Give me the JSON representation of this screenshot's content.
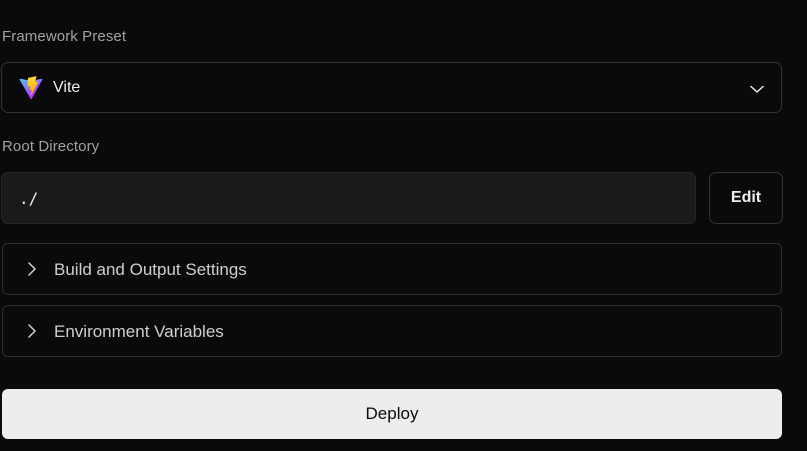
{
  "framework_preset": {
    "label": "Framework Preset",
    "selected": "Vite",
    "icon": "vite-logo"
  },
  "root_directory": {
    "label": "Root Directory",
    "value": "./",
    "edit_label": "Edit"
  },
  "sections": [
    {
      "label": "Build and Output Settings",
      "icon": "chevron-right-icon"
    },
    {
      "label": "Environment Variables",
      "icon": "chevron-right-icon"
    }
  ],
  "deploy_label": "Deploy",
  "colors": {
    "background": "#0a0a0a",
    "input_bg": "#1a1a1a",
    "border": "#333333",
    "deploy_bg": "#ededed",
    "vite_purple": "#9f6bff",
    "vite_yellow": "#ffc517"
  }
}
